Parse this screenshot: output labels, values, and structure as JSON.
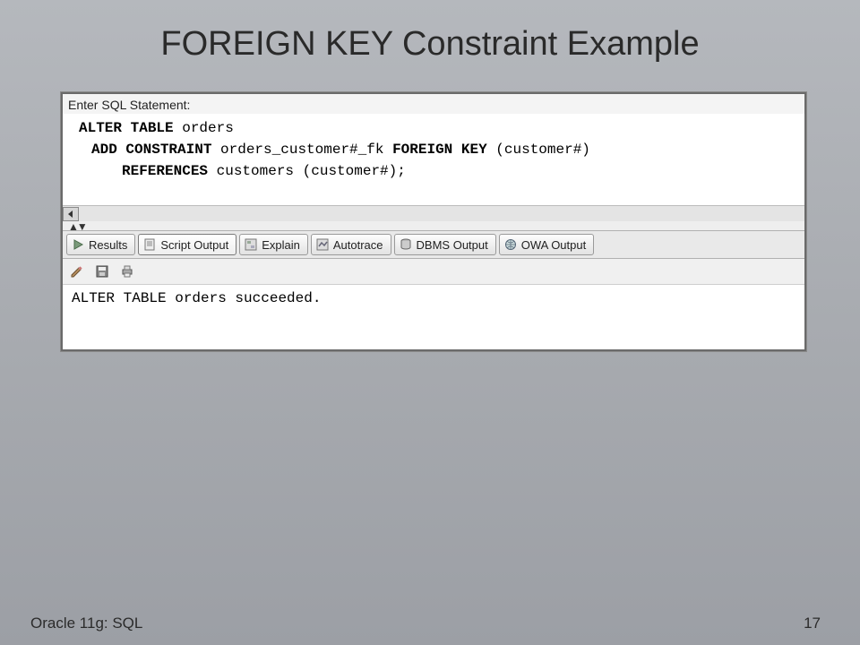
{
  "title": "FOREIGN KEY Constraint Example",
  "editor": {
    "prompt": "Enter SQL Statement:",
    "line1_kw1": "ALTER TABLE",
    "line1_rest": " orders",
    "line2_kw1": "ADD CONSTRAINT",
    "line2_mid": " orders_customer#_fk ",
    "line2_kw2": "FOREIGN KEY",
    "line2_rest": " (customer#)",
    "line3_kw1": "REFERENCES",
    "line3_rest": " customers (customer#);"
  },
  "tabs": {
    "results": "Results",
    "script_output": "Script Output",
    "explain": "Explain",
    "autotrace": "Autotrace",
    "dbms_output": "DBMS Output",
    "owa_output": "OWA Output"
  },
  "output": {
    "message": "ALTER TABLE orders succeeded."
  },
  "footer": {
    "left": "Oracle 11g: SQL",
    "page": "17"
  }
}
